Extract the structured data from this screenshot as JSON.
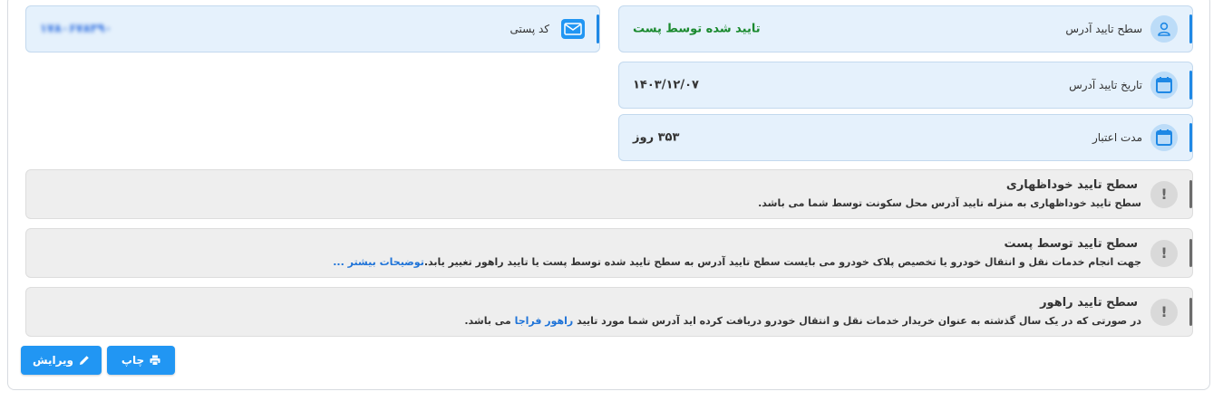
{
  "cards": {
    "level": {
      "label": "سطح تایید آدرس",
      "value": "تایید شده توسط پست"
    },
    "postal": {
      "label": "کد پستی",
      "value": "۱۷۸۰۶۷۸۳۹۰"
    },
    "date": {
      "label": "تاریخ تایید آدرس",
      "value": "۱۴۰۳/۱۲/۰۷"
    },
    "validity": {
      "label": "مدت اعتبار",
      "value": "۳۵۳ روز"
    }
  },
  "notes": [
    {
      "title": "سطح تایید خوداظهاری",
      "text": "سطح تایید خوداظهاری به منزله تایید آدرس محل سکونت توسط شما می باشد."
    },
    {
      "title": "سطح تایید توسط پست",
      "text": "جهت انجام خدمات نقل و انتقال خودرو یا تخصیص پلاک خودرو می بایست سطح تایید آدرس به سطح تایید شده توسط پست یا تایید راهور تغییر یابد.",
      "link": "توضیحات بیشتر ..."
    },
    {
      "title": "سطح تایید راهور",
      "text_before": "در صورتی که در یک سال گذشته به عنوان خریدار خدمات نقل و انتقال خودرو دریافت کرده اید آدرس شما مورد تایید",
      "link": "راهور فراجا",
      "text_after": "می باشد."
    }
  ],
  "buttons": {
    "print": "چاپ",
    "edit": "ویرایش"
  },
  "icons": [
    "user-icon",
    "mail-icon",
    "calendar-icon",
    "calendar-icon",
    "exclamation-icon",
    "print-icon",
    "pencil-icon"
  ],
  "colors": {
    "accent": "#1e88e5",
    "card_bg": "#e5f1fc",
    "verified_text": "#1b8a2f",
    "note_bg": "#eeeeee",
    "link": "#1e73d8",
    "button": "#2196f3"
  }
}
